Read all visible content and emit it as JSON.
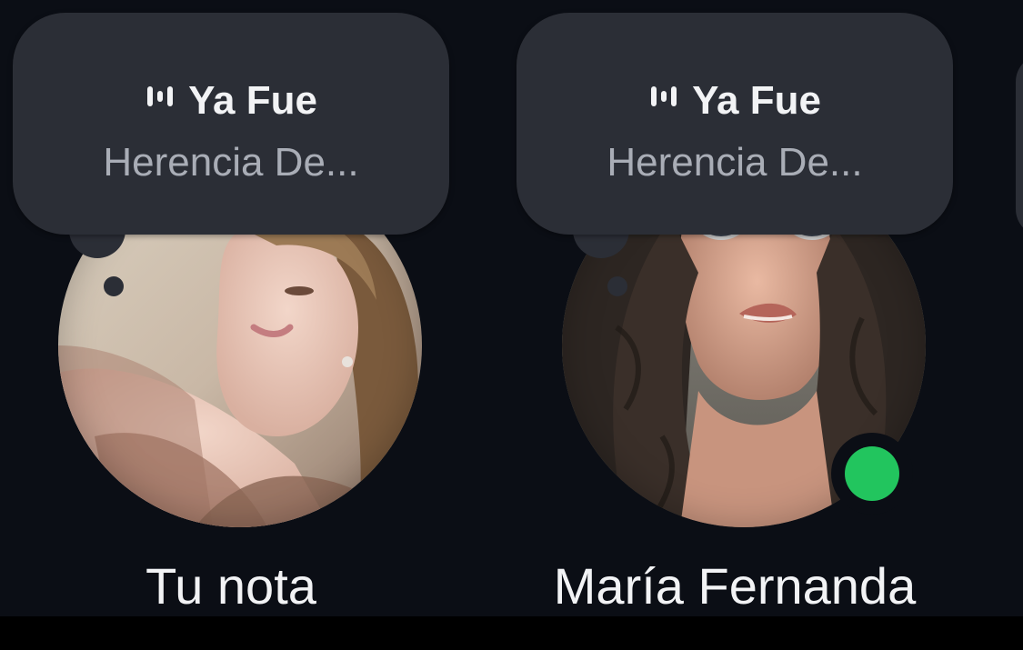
{
  "notes": [
    {
      "note": {
        "track": "Ya Fue",
        "artist": "Herencia De..."
      },
      "name": "Tu nota",
      "online": false
    },
    {
      "note": {
        "track": "Ya Fue",
        "artist": "Herencia De..."
      },
      "name": "María Fernanda",
      "online": true
    }
  ],
  "colors": {
    "background": "#0b0e15",
    "bubble": "#2b2e36",
    "online": "#22c55e",
    "text": "#f2f3f5",
    "subtext": "#a9adb6"
  },
  "icons": {
    "music": "sound-wave-icon"
  }
}
